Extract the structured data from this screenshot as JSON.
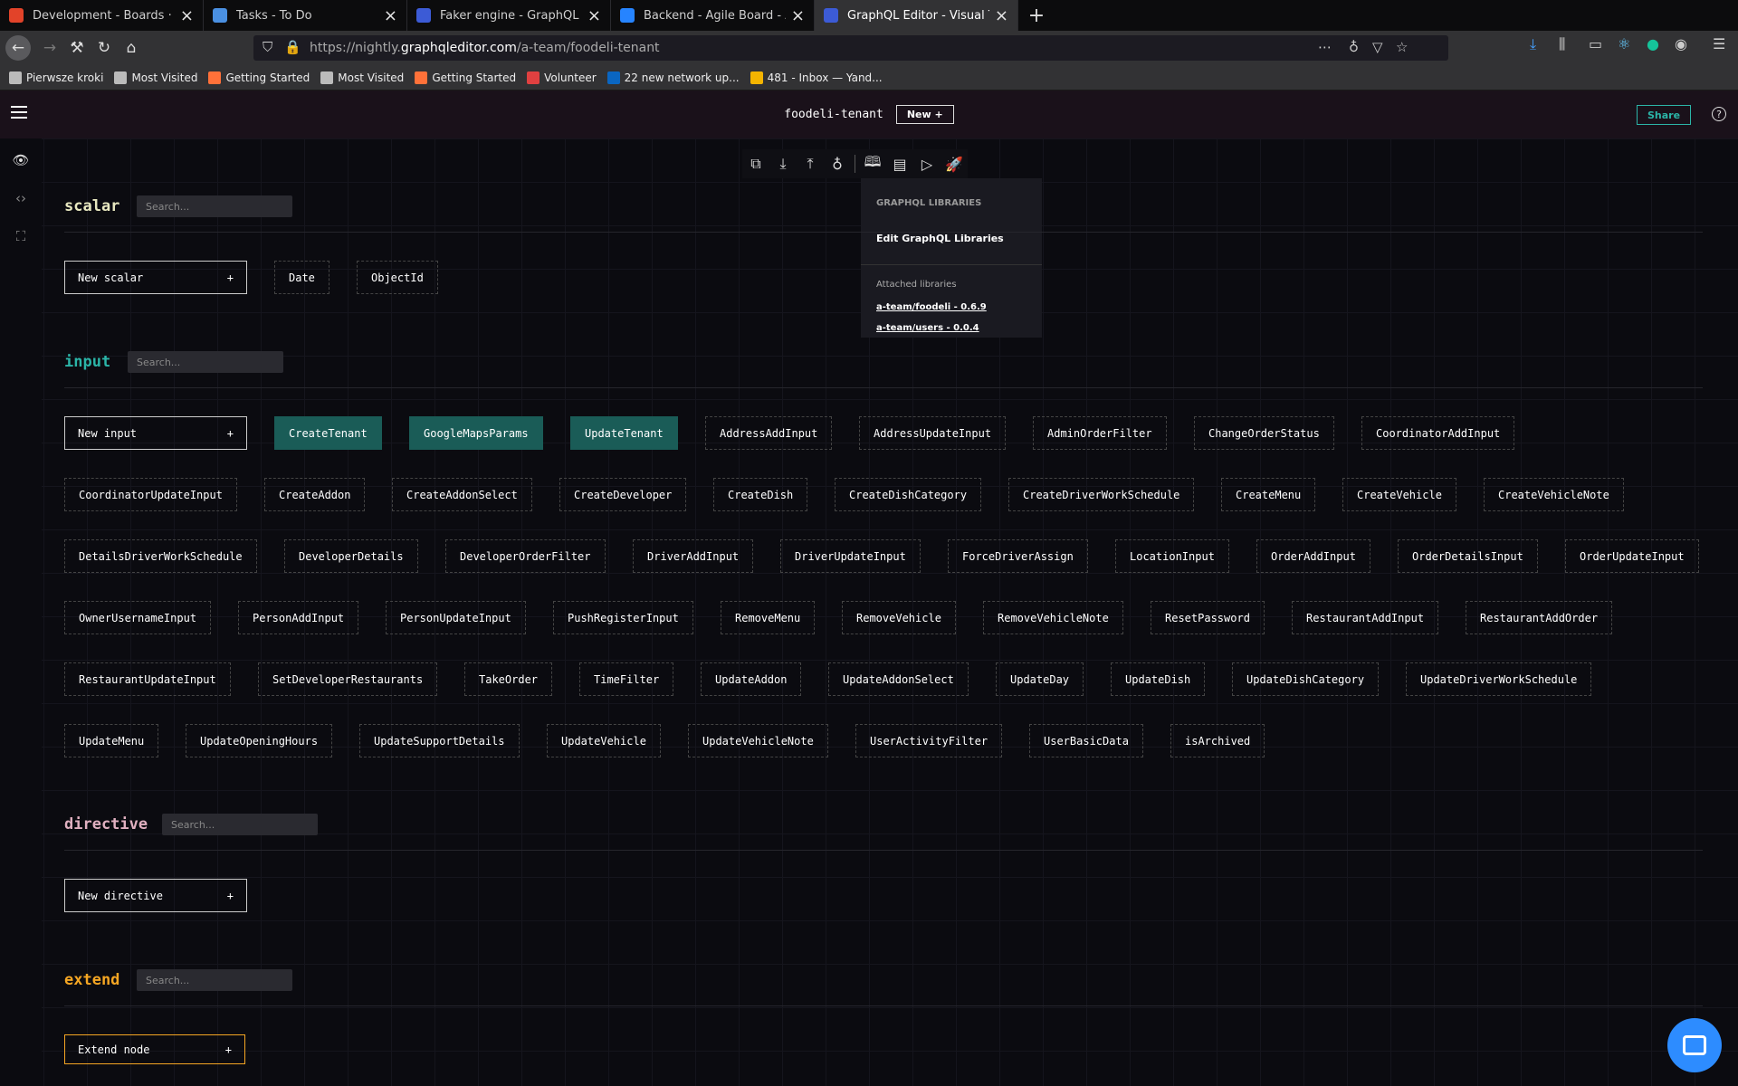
{
  "browser": {
    "tabs": [
      {
        "title": "Development - Boards · Aexol /",
        "icon": "gitlab-icon",
        "color": "#e24329"
      },
      {
        "title": "Tasks - To Do",
        "icon": "check-icon",
        "color": "#4a90e2"
      },
      {
        "title": "Faker engine - GraphQL Editor",
        "icon": "graphql-icon",
        "color": "#3c5bd6"
      },
      {
        "title": "Backend - Agile Board - Aexol J",
        "icon": "jira-icon",
        "color": "#2684ff"
      },
      {
        "title": "GraphQL Editor - Visual Tool fo",
        "icon": "graphql-icon",
        "color": "#3c5bd6"
      }
    ],
    "url_prefix": "https://nightly.",
    "url_domain": "graphqleditor.com",
    "url_path": "/a-team/foodeli-tenant",
    "bookmarks": [
      {
        "label": "Pierwsze kroki",
        "icon": "globe-icon"
      },
      {
        "label": "Most Visited",
        "icon": "gear-icon"
      },
      {
        "label": "Getting Started",
        "icon": "firefox-icon"
      },
      {
        "label": "Most Visited",
        "icon": "gear-icon"
      },
      {
        "label": "Getting Started",
        "icon": "firefox-icon"
      },
      {
        "label": "Volunteer",
        "icon": "volunteer-icon"
      },
      {
        "label": "22 new network up...",
        "icon": "linkedin-icon"
      },
      {
        "label": "481 - Inbox — Yand...",
        "icon": "mail-icon"
      }
    ]
  },
  "app": {
    "project": "foodeli-tenant",
    "new_label": "New +",
    "share_label": "Share",
    "help_label": "?"
  },
  "library_panel": {
    "heading": "GRAPHQL LIBRARIES",
    "edit": "Edit GraphQL Libraries",
    "attached": "Attached libraries",
    "libs": [
      "a-team/foodeli - 0.6.9",
      "a-team/users - 0.0.4"
    ]
  },
  "sections": {
    "scalar": {
      "title": "scalar",
      "color": "#e8e8c0",
      "search": "Search...",
      "new_label": "New scalar",
      "nodes": [
        "Date",
        "ObjectId"
      ]
    },
    "input": {
      "title": "input",
      "color": "#2bb5a8",
      "search": "Search...",
      "new_label": "New input",
      "selected": [
        "CreateTenant",
        "GoogleMapsParams",
        "UpdateTenant"
      ],
      "rows": [
        [
          "CreateTenant",
          "GoogleMapsParams",
          "UpdateTenant",
          "AddressAddInput",
          "AddressUpdateInput",
          "AdminOrderFilter",
          "ChangeOrderStatus",
          "CoordinatorAddInput"
        ],
        [
          "CoordinatorUpdateInput",
          "CreateAddon",
          "CreateAddonSelect",
          "CreateDeveloper",
          "CreateDish",
          "CreateDishCategory",
          "CreateDriverWorkSchedule",
          "CreateMenu",
          "CreateVehicle",
          "CreateVehicleNote"
        ],
        [
          "DetailsDriverWorkSchedule",
          "DeveloperDetails",
          "DeveloperOrderFilter",
          "DriverAddInput",
          "DriverUpdateInput",
          "ForceDriverAssign",
          "LocationInput",
          "OrderAddInput",
          "OrderDetailsInput",
          "OrderUpdateInput"
        ],
        [
          "OwnerUsernameInput",
          "PersonAddInput",
          "PersonUpdateInput",
          "PushRegisterInput",
          "RemoveMenu",
          "RemoveVehicle",
          "RemoveVehicleNote",
          "ResetPassword",
          "RestaurantAddInput",
          "RestaurantAddOrder"
        ],
        [
          "RestaurantUpdateInput",
          "SetDeveloperRestaurants",
          "TakeOrder",
          "TimeFilter",
          "UpdateAddon",
          "UpdateAddonSelect",
          "UpdateDay",
          "UpdateDish",
          "UpdateDishCategory",
          "UpdateDriverWorkSchedule"
        ],
        [
          "UpdateMenu",
          "UpdateOpeningHours",
          "UpdateSupportDetails",
          "UpdateVehicle",
          "UpdateVehicleNote",
          "UserActivityFilter",
          "UserBasicData",
          "isArchived"
        ]
      ]
    },
    "directive": {
      "title": "directive",
      "color": "#e0b0c0",
      "search": "Search...",
      "new_label": "New directive"
    },
    "extend": {
      "title": "extend",
      "color": "#f5a623",
      "search": "Search...",
      "new_label": "Extend node"
    }
  }
}
